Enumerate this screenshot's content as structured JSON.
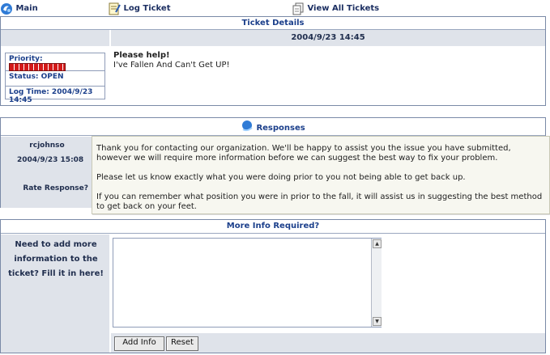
{
  "nav": {
    "main": "Main",
    "log_ticket": "Log Ticket",
    "view_all": "View All Tickets"
  },
  "ticket": {
    "section_title": "Ticket Details",
    "date": "2004/9/23 14:45",
    "priority_label": "Priority:",
    "status": "Status: OPEN",
    "log_time": "Log Time: 2004/9/23 14:45",
    "subject": "Please help!",
    "body": "I've Fallen And Can't Get UP!"
  },
  "responses": {
    "section_title": "Responses",
    "user": "rcjohnso",
    "date": "2004/9/23 15:08",
    "rate_label": "Rate Response?",
    "tooltip": {
      "p1": "Thank you for contacting our organization. We'll be happy to assist you the issue you have submitted, however we will require more information before we can suggest the best way to fix your problem.",
      "p2": "Please let us know exactly what you were doing prior to you not being able to get back up.",
      "p3": "If you can remember what position you were in prior to the fall, it will assist us in suggesting the best method to get back on your feet."
    }
  },
  "more_info": {
    "section_title": "More Info Required?",
    "prompt": "Need to add more information to the ticket? Fill it in here!",
    "textarea_value": "",
    "add_button": "Add Info",
    "reset_button": "Reset"
  },
  "icons": {
    "main": "main-swirl-icon",
    "log_ticket": "notepad-icon",
    "view_all": "documents-icon",
    "responses": "responses-icon"
  },
  "colors": {
    "accent": "#1b3f8b",
    "panel_grey": "#dfe3ea",
    "priority_red": "#d31919"
  }
}
